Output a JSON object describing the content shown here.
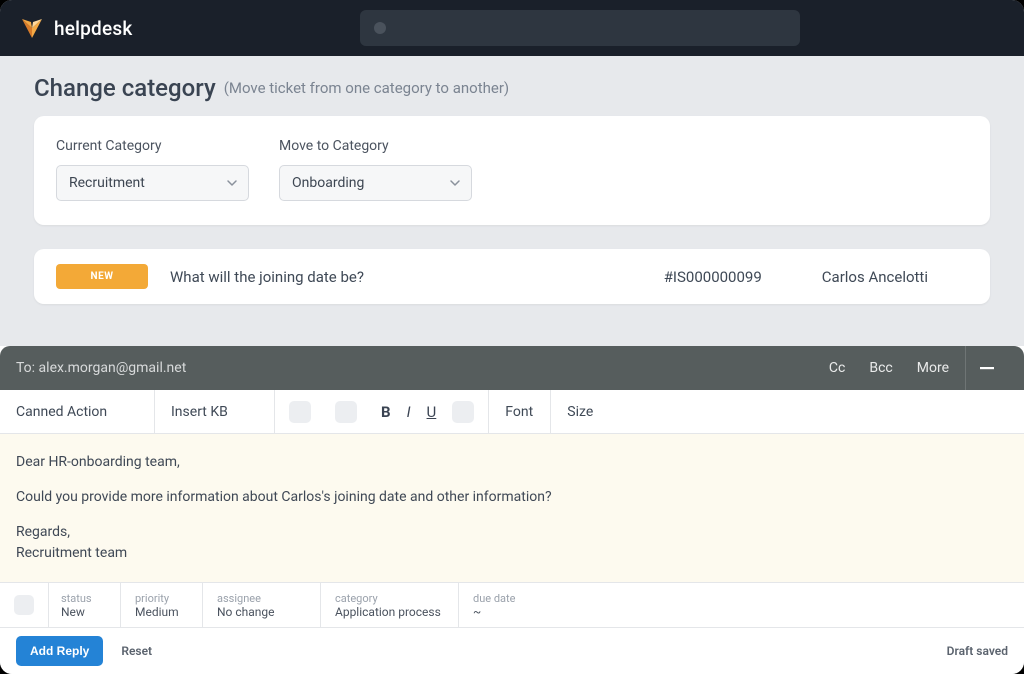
{
  "brand": "helpdesk",
  "page": {
    "title": "Change category",
    "subtitle": "(Move ticket from one category to another)"
  },
  "category": {
    "current_label": "Current Category",
    "current_value": "Recruitment",
    "moveto_label": "Move to Category",
    "moveto_value": "Onboarding"
  },
  "ticket": {
    "status": "NEW",
    "title": "What will the joining date be?",
    "id": "#IS000000099",
    "assignee": "Carlos Ancelotti"
  },
  "editor": {
    "to_label": "To:",
    "to_value": "alex.morgan@gmail.net",
    "cc": "Cc",
    "bcc": "Bcc",
    "more": "More",
    "toolbar": {
      "canned": "Canned Action",
      "insertkb": "Insert KB",
      "bold": "B",
      "italic": "I",
      "underline": "U",
      "font": "Font",
      "size": "Size"
    },
    "body": {
      "greeting": "Dear HR-onboarding team,",
      "para1": "Could you provide more information about Carlos's joining date and other information?",
      "regards": "Regards,",
      "signature": "Recruitment team"
    },
    "meta": {
      "status_label": "status",
      "status_value": "New",
      "priority_label": "priority",
      "priority_value": "Medium",
      "assignee_label": "assignee",
      "assignee_value": "No change",
      "category_label": "category",
      "category_value": "Application process",
      "due_label": "due date",
      "due_value": "~"
    },
    "footer": {
      "add_reply": "Add Reply",
      "reset": "Reset",
      "draft_saved": "Draft saved"
    }
  }
}
